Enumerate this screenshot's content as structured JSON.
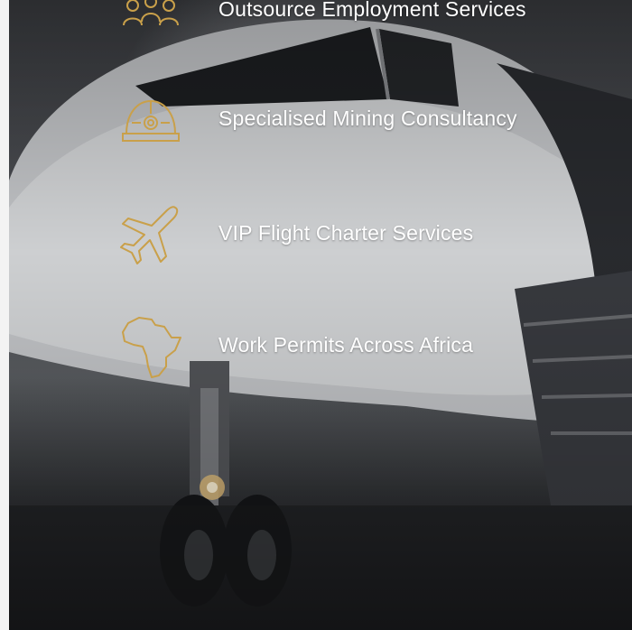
{
  "colors": {
    "icon_gold": "#c9a04a",
    "text": "#ffffff"
  },
  "services": [
    {
      "label": "Outsource Employment Services",
      "icon": "team-people-icon"
    },
    {
      "label": "Specialised Mining Consultancy",
      "icon": "mining-helmet-icon"
    },
    {
      "label": "VIP Flight Charter Services",
      "icon": "airplane-icon"
    },
    {
      "label": "Work Permits Across Africa",
      "icon": "africa-map-icon"
    }
  ]
}
